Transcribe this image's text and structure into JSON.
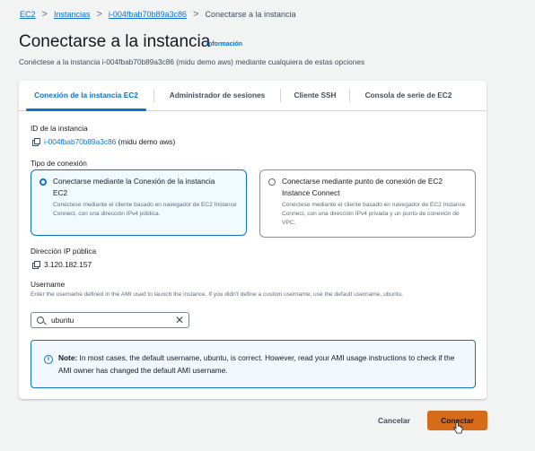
{
  "breadcrumb": {
    "items": [
      "EC2",
      "Instancias",
      "i-004fbab70b89a3c86"
    ],
    "separator": ">",
    "current": "Conectarse a la instancia"
  },
  "header": {
    "title": "Conectarse a la instancia",
    "info_link": "Información",
    "subtitle": "Conéctese a la instancia i-004fbab70b89a3c86 (midu demo aws) mediante cualquiera de estas opciones"
  },
  "tabs": [
    {
      "label": "Conexión de la instancia EC2",
      "active": true
    },
    {
      "label": "Administrador de sesiones",
      "active": false
    },
    {
      "label": "Cliente SSH",
      "active": false
    },
    {
      "label": "Consola de serie de EC2",
      "active": false
    }
  ],
  "instance": {
    "id_label": "ID de la instancia",
    "id_link": "i-004fbab70b89a3c86",
    "id_suffix": "(midu demo aws)"
  },
  "connection_type": {
    "label": "Tipo de conexión",
    "options": [
      {
        "title": "Conectarse mediante la Conexión de la instancia EC2",
        "description": "Conéctese mediante el cliente basado en navegador de EC2 Instance Connect, con una dirección IPv4 pública.",
        "selected": true
      },
      {
        "title": "Conectarse mediante punto de conexión de EC2 Instance Connect",
        "description": "Conéctese mediante el cliente basado en navegador de EC2 Instance Connect, con una dirección IPv4 privada y un punto de conexión de VPC.",
        "selected": false
      }
    ]
  },
  "public_ip": {
    "label": "Dirección IP pública",
    "value": "3.120.182.157"
  },
  "username": {
    "label": "Username",
    "help": "Enter the username defined in the AMI used to launch the instance. If you didn't define a custom username, use the default username, ubuntu.",
    "value": "ubuntu"
  },
  "alert": {
    "strong": "Note:",
    "text": " In most cases, the default username, ubuntu, is correct. However, read your AMI usage instructions to check if the AMI owner has changed the default AMI username."
  },
  "footer": {
    "cancel_label": "Cancelar",
    "connect_label": "Conectar"
  },
  "colors": {
    "accent": "#0972d3",
    "primary_button": "#d66b1a",
    "background": "#f2f3f3"
  },
  "icons": [
    "copy-icon",
    "search-icon",
    "clear-icon",
    "info-icon",
    "chevron-right-icon",
    "radio-icon",
    "hand-cursor-icon"
  ]
}
